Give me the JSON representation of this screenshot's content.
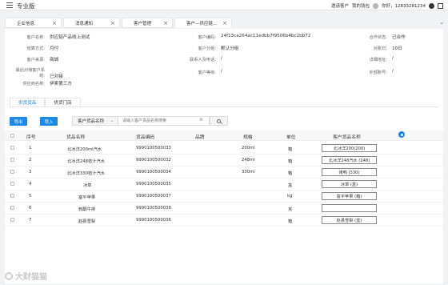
{
  "app": {
    "title": "专业版"
  },
  "topbar": {
    "invite": "邀请客户",
    "wallet": "我的钱包",
    "greeting": "你好，12833281234"
  },
  "tabs": [
    {
      "label": "企业信息"
    },
    {
      "label": "消息通知"
    },
    {
      "label": "客户管理"
    },
    {
      "label": "客户—供应链..."
    }
  ],
  "info": {
    "customer_name_label": "客户名称:",
    "customer_name": "供应链产品线上测试",
    "customer_id_label": "客户编码:",
    "customer_id": "24f13ca264ac11edbb7f9506b4bc2bb72",
    "coop_status_label": "合作状态:",
    "coop_status": "已合作",
    "settle_label": "结算方式:",
    "settle": "月付",
    "group_label": "客户分组:",
    "group": "默认分组",
    "settle_day_label": "对账日:",
    "settle_day": "10日",
    "source_label": "客户来源:",
    "source": "商城",
    "contact_label": "联系人及电话:",
    "contact": "/",
    "address_label": "详细地址:",
    "address": "/",
    "latest_label_1": "最后对接客户系",
    "latest_label_2": "统:",
    "latest": "已对接",
    "level_label": "客户等级:",
    "level": "/",
    "ext_label": "外部账号:",
    "ext": "/",
    "supplier_label": "供应商名称:",
    "supplier": "伊索第三方"
  },
  "inner_tabs": [
    {
      "label": "供货货品"
    },
    {
      "label": "供货门店"
    }
  ],
  "toolbar": {
    "export_label": "导出",
    "import_label": "导入",
    "select_value": "客户货品名称",
    "search_placeholder": "请输入客户货品名称搜索"
  },
  "table": {
    "headers": {
      "seq": "序号",
      "name": "货品名称",
      "code": "货品编码",
      "brand": "品牌",
      "spec": "规格",
      "unit": "单位",
      "cust_name": "客户货品名称"
    },
    "rows": [
      {
        "seq": "1",
        "name": "北冰洋200ml汽水",
        "code": "9990100500033",
        "brand": "",
        "spec": "200ml",
        "unit": "箱",
        "cust_name": "北冰洋200(200)"
      },
      {
        "seq": "2",
        "name": "北冰洋248桔汁汽水",
        "code": "9990100500032",
        "brand": "",
        "spec": "248ml",
        "unit": "箱",
        "cust_name": "北冰洋248汽水 (248)"
      },
      {
        "seq": "3",
        "name": "北冰洋330桔汁汽水",
        "code": "9990100500034",
        "brand": "",
        "spec": "330ml",
        "unit": "箱",
        "cust_name": "烤鸭 (330)"
      },
      {
        "seq": "4",
        "name": "冰草",
        "code": "9990100500035",
        "brand": "",
        "spec": "",
        "unit": "盒",
        "cust_name": "冰草 (盒)"
      },
      {
        "seq": "5",
        "name": "富平苹果",
        "code": "9990100500037",
        "brand": "",
        "spec": "",
        "unit": "kg",
        "cust_name": "富平苹果 (箱)"
      },
      {
        "seq": "6",
        "name": "勃酮牛排",
        "code": "9990100500038",
        "brand": "",
        "spec": "",
        "unit": "克",
        "cust_name": ""
      },
      {
        "seq": "7",
        "name": "赵县雪梨",
        "code": "9990100500036",
        "brand": "",
        "spec": "",
        "unit": "箱",
        "cust_name": "赵县雪梨 (盒)"
      }
    ]
  },
  "watermark": {
    "text": "大财猫猫"
  }
}
